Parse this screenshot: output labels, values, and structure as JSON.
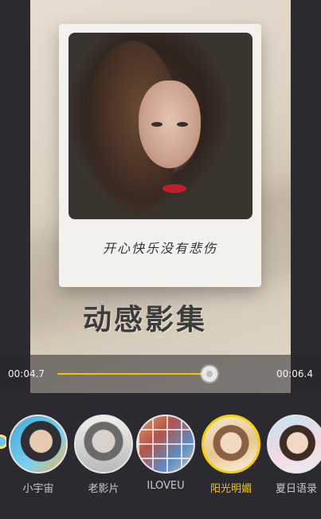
{
  "preview": {
    "caption": "开心快乐没有悲伤",
    "title": "动感影集"
  },
  "timeline": {
    "current_time": "00:04.7",
    "total_time": "00:06.4",
    "progress": 0.73
  },
  "templates": [
    {
      "label": "小宇宙",
      "thumb": "th1",
      "active": false
    },
    {
      "label": "老影片",
      "thumb": "th2",
      "active": false
    },
    {
      "label": "ILOVEU",
      "thumb": "th3",
      "active": false
    },
    {
      "label": "阳光明媚",
      "thumb": "th4",
      "active": true
    },
    {
      "label": "夏日语录",
      "thumb": "th5",
      "active": false
    }
  ],
  "colors": {
    "accent": "#f5c400",
    "background": "#2b2a30"
  }
}
